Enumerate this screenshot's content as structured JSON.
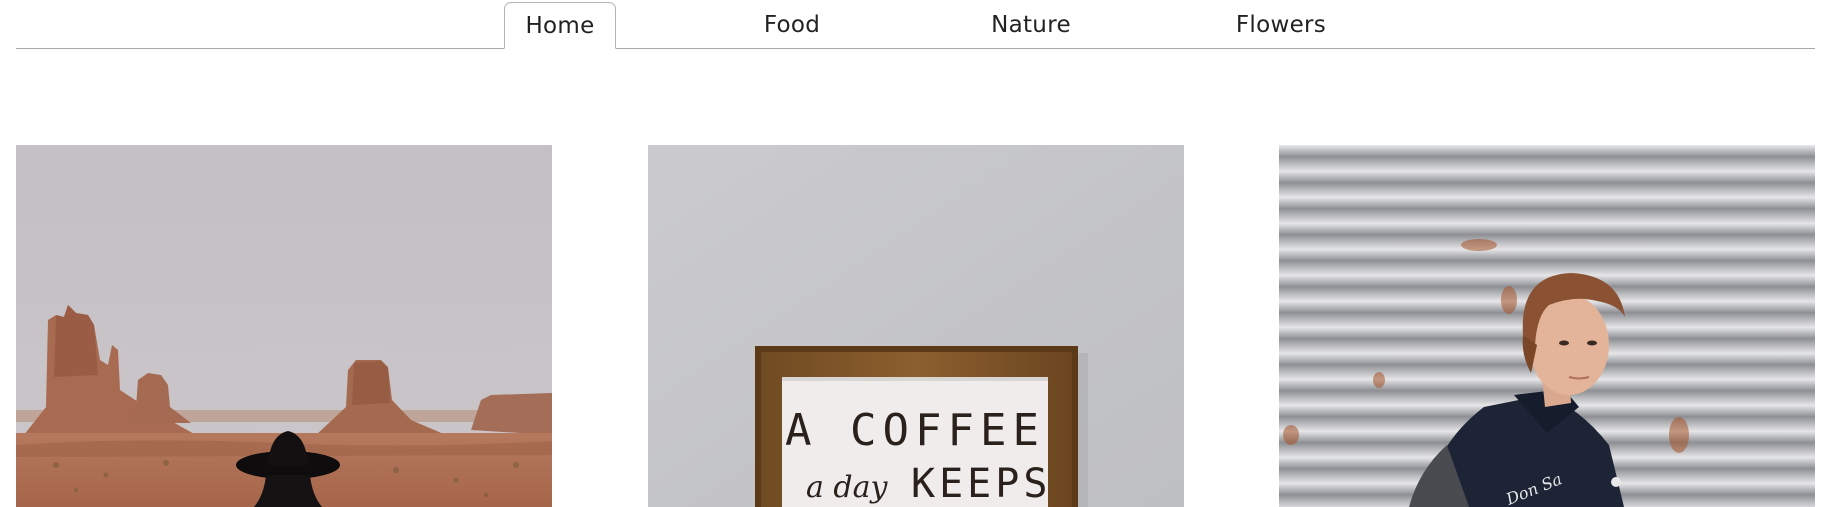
{
  "nav": {
    "tabs": [
      {
        "label": "Home",
        "active": true
      },
      {
        "label": "Food",
        "active": false
      },
      {
        "label": "Nature",
        "active": false
      },
      {
        "label": "Flowers",
        "active": false
      }
    ]
  },
  "gallery": {
    "items": [
      {
        "subject": "desert buttes with woman in black hat"
      },
      {
        "subject": "framed coffee sign",
        "sign_line1": "A COFFEE",
        "sign_line2_script": "a day",
        "sign_line2_caps": "KEEPS"
      },
      {
        "subject": "young man in varsity jacket against corrugated metal",
        "jacket_script": "Don Sa"
      }
    ]
  },
  "colors": {
    "divider": "#a8a8a8",
    "tab_border": "#b4b4b4",
    "text": "#222222"
  }
}
